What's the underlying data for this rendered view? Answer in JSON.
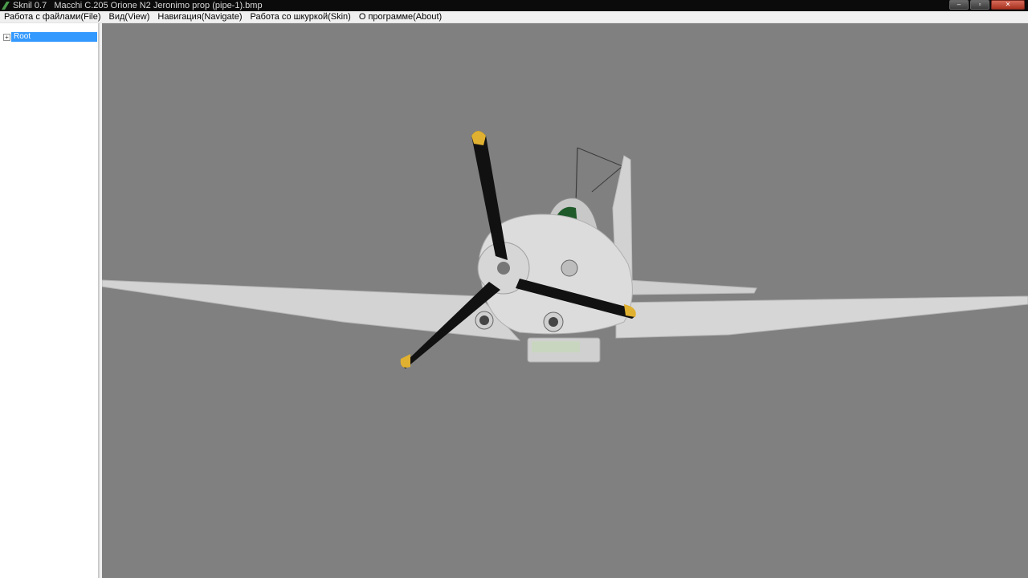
{
  "window": {
    "title": "Sknil 0.7   Macchi C.205 Orione N2 Jeronimo prop (pipe-1).bmp",
    "controls": [
      "minimize",
      "maximize",
      "close"
    ]
  },
  "menu": {
    "items": [
      {
        "label": "Работа с файлами(File)"
      },
      {
        "label": "Вид(View)"
      },
      {
        "label": "Навигация(Navigate)"
      },
      {
        "label": "Работа со шкуркой(Skin)"
      },
      {
        "label": "О программе(About)"
      }
    ]
  },
  "tree": {
    "root_label": "Root",
    "expander": "+"
  },
  "viewport": {
    "background": "#808080",
    "model_color": "#d4d4d4",
    "prop_color": "#111111",
    "prop_tip_color": "#e0b030"
  }
}
